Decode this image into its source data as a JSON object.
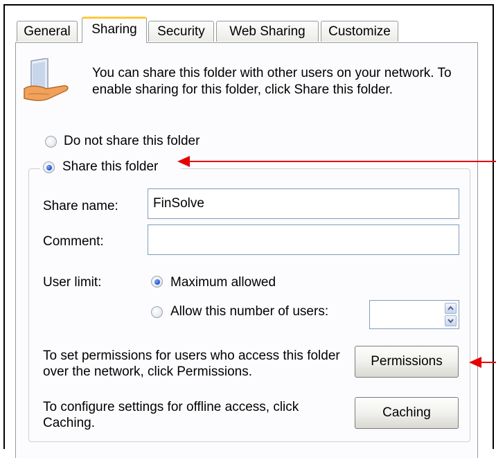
{
  "tabs": [
    {
      "label": "General"
    },
    {
      "label": "Sharing"
    },
    {
      "label": "Security"
    },
    {
      "label": "Web Sharing"
    },
    {
      "label": "Customize"
    }
  ],
  "info": {
    "text": "You can share this folder with other users on your network.  To enable sharing for this folder, click Share this folder.",
    "icon": "shared-folder-hand-icon"
  },
  "sharing_options": {
    "do_not_share_label": "Do not share this folder",
    "share_label": "Share this folder",
    "selected": "share"
  },
  "share_name": {
    "label": "Share name:",
    "value": "FinSolve"
  },
  "comment": {
    "label": "Comment:",
    "value": ""
  },
  "user_limit": {
    "label": "User limit:",
    "max_label": "Maximum allowed",
    "allow_label": "Allow this number of users:",
    "selected": "max",
    "value": ""
  },
  "permissions": {
    "text": "To set permissions for users who access this folder over the network, click Permissions.",
    "button_label": "Permissions"
  },
  "caching": {
    "text": "To configure settings for offline access, click Caching.",
    "button_label": "Caching"
  },
  "colors": {
    "annotation_arrow": "#e60000",
    "tab_highlight": "#ffc83c"
  }
}
